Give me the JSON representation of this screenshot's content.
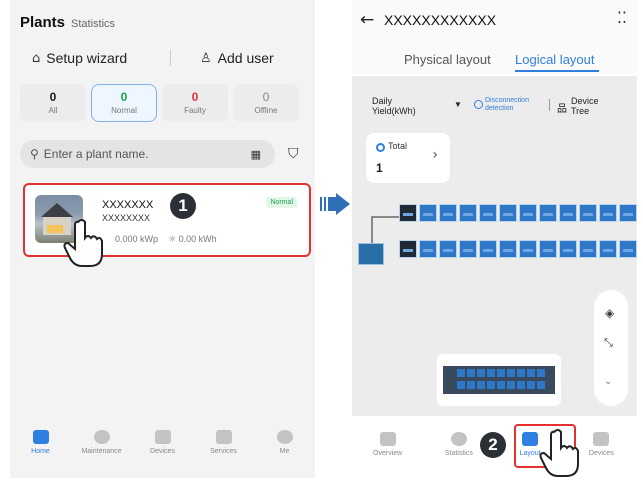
{
  "left": {
    "header": {
      "title": "Plants",
      "subtitle": "Statistics"
    },
    "actions": {
      "setup_label": "Setup wizard",
      "add_user_label": "Add user"
    },
    "filters": [
      {
        "count": "0",
        "label": "All"
      },
      {
        "count": "0",
        "label": "Normal"
      },
      {
        "count": "0",
        "label": "Faulty"
      },
      {
        "count": "0",
        "label": "Offline"
      }
    ],
    "search": {
      "placeholder": "Enter a plant name."
    },
    "plant": {
      "name": "XXXXXXX",
      "sub": "XXXXXXXX",
      "capacity": "0.000 kWp",
      "energy": "0.00 kWh",
      "status": "Normal"
    },
    "nav": [
      "Home",
      "Maintenance",
      "Devices",
      "Services",
      "Me"
    ]
  },
  "right": {
    "title": "XXXXXXXXXXXX",
    "tabs": [
      "Physical layout",
      "Logical layout"
    ],
    "controls": {
      "daily_yield": "Daily\nYield(kWh)",
      "disconnection": "Disconnection\ndetection",
      "device_tree": "Device\nTree"
    },
    "total": {
      "label": "Total",
      "value": "1"
    },
    "nav": [
      "Overview",
      "Statistics",
      "Layout",
      "Devices"
    ]
  },
  "steps": [
    "1",
    "2"
  ],
  "colors": {
    "accent": "#2f7fe0",
    "highlight": "#e53030",
    "panel": "#2f78c8"
  },
  "icons": [
    "home-icon",
    "wizard-icon",
    "add-user-icon",
    "search-icon",
    "qr-icon",
    "filter-icon",
    "back-icon",
    "more-icon",
    "layers-icon",
    "collapse-icon",
    "chevron-down-icon",
    "layout-icon"
  ]
}
